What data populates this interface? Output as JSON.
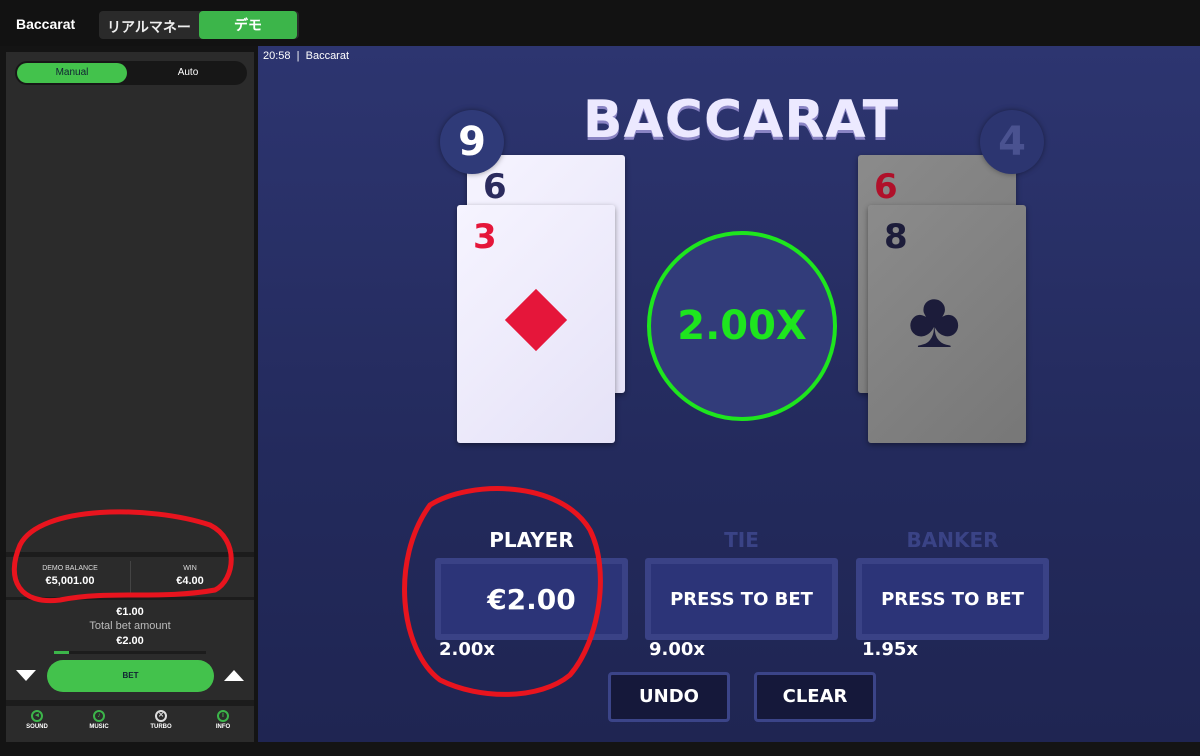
{
  "header": {
    "title": "Baccarat",
    "modes": [
      "リアルマネー",
      "デモ"
    ],
    "active_mode": "デモ"
  },
  "sidebar": {
    "tabs": [
      "Manual",
      "Auto"
    ],
    "active_tab": "Manual",
    "balance_label": "DEMO BALANCE",
    "balance": "€5,001.00",
    "win_label": "WIN",
    "win": "€4.00",
    "chip_value": "€1.00",
    "total_label": "Total bet amount",
    "total": "€2.00",
    "bet_progress": 0.1,
    "bet_label": "BET",
    "controls": [
      {
        "label": "SOUND",
        "icon": "speaker-icon"
      },
      {
        "label": "MUSIC",
        "icon": "music-icon"
      },
      {
        "label": "TURBO",
        "icon": "turbo-icon"
      },
      {
        "label": "INFO",
        "icon": "info-icon"
      }
    ]
  },
  "game": {
    "status": "20:58  |  Baccarat",
    "logo": "BACCARAT",
    "player_score": "9",
    "banker_score": "4",
    "player_cards": [
      {
        "rank": "6",
        "suit": "",
        "color": "#2b2b5e"
      },
      {
        "rank": "3",
        "suit": "diamond",
        "color": "#e5163a"
      }
    ],
    "banker_cards": [
      {
        "rank": "6",
        "suit": "",
        "color": "#b0102a"
      },
      {
        "rank": "8",
        "suit": "club",
        "color": "#1c1c3a"
      }
    ],
    "multiplier": "2.00X",
    "accent": "#1ee61e",
    "bets": [
      {
        "label": "PLAYER",
        "value": "€2.00",
        "odds": "2.00x"
      },
      {
        "label": "TIE",
        "value": "PRESS TO BET",
        "odds": "9.00x"
      },
      {
        "label": "BANKER",
        "value": "PRESS TO BET",
        "odds": "1.95x"
      }
    ],
    "undo": "UNDO",
    "clear": "CLEAR"
  }
}
